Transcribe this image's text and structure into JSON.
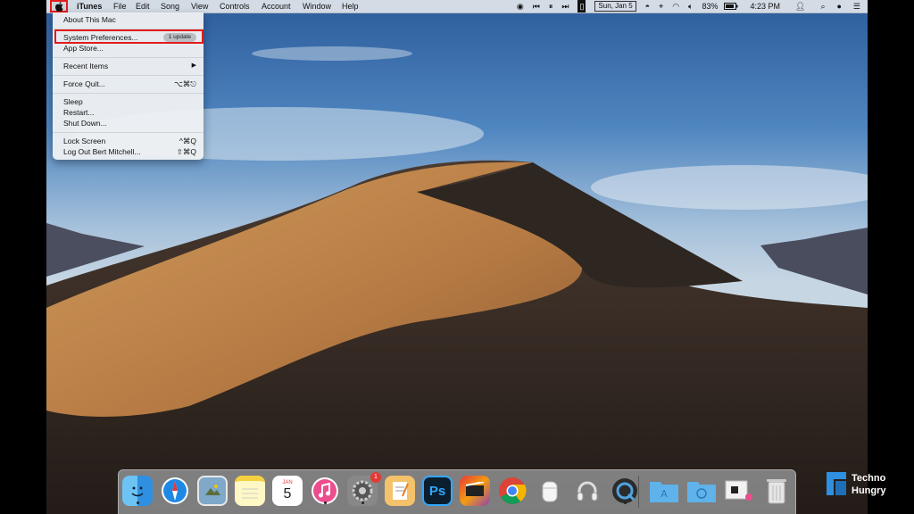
{
  "menubar": {
    "app_name": "iTunes",
    "menus": [
      "File",
      "Edit",
      "Song",
      "View",
      "Controls",
      "Account",
      "Window",
      "Help"
    ],
    "date": "Sun, Jan 5",
    "battery": "83%",
    "time": "4:23 PM"
  },
  "apple_menu": {
    "items": [
      {
        "label": "About This Mac"
      },
      {
        "label": "System Preferences...",
        "badge": "1 update"
      },
      {
        "label": "App Store..."
      },
      {
        "label": "Recent Items",
        "submenu_arrow": "▶"
      },
      {
        "label": "Force Quit...",
        "shortcut": "⌥⌘⎋"
      },
      {
        "label": "Sleep"
      },
      {
        "label": "Restart..."
      },
      {
        "label": "Shut Down..."
      },
      {
        "label": "Lock Screen",
        "shortcut": "^⌘Q"
      },
      {
        "label": "Log Out Bert Mitchell...",
        "shortcut": "⇧⌘Q"
      }
    ]
  },
  "dock": {
    "calendar_month": "JAN",
    "calendar_day": "5",
    "system_prefs_badge": "1",
    "photoshop_label": "Ps",
    "items": [
      "finder-icon",
      "safari-icon",
      "preview-icon",
      "notes-icon",
      "calendar-icon",
      "itunes-icon",
      "system-preferences-icon",
      "pages-icon",
      "photoshop-icon",
      "final-cut-icon",
      "chrome-icon",
      "airpods-icon",
      "headphones-icon",
      "quicktime-icon",
      "applications-folder-icon",
      "downloads-folder-icon",
      "documents-stack-icon",
      "trash-icon"
    ]
  },
  "watermark": {
    "line1": "Techno",
    "line2": "Hungry"
  },
  "colors": {
    "highlight": "#e21b1b",
    "menubar": "#e2e6ec"
  }
}
